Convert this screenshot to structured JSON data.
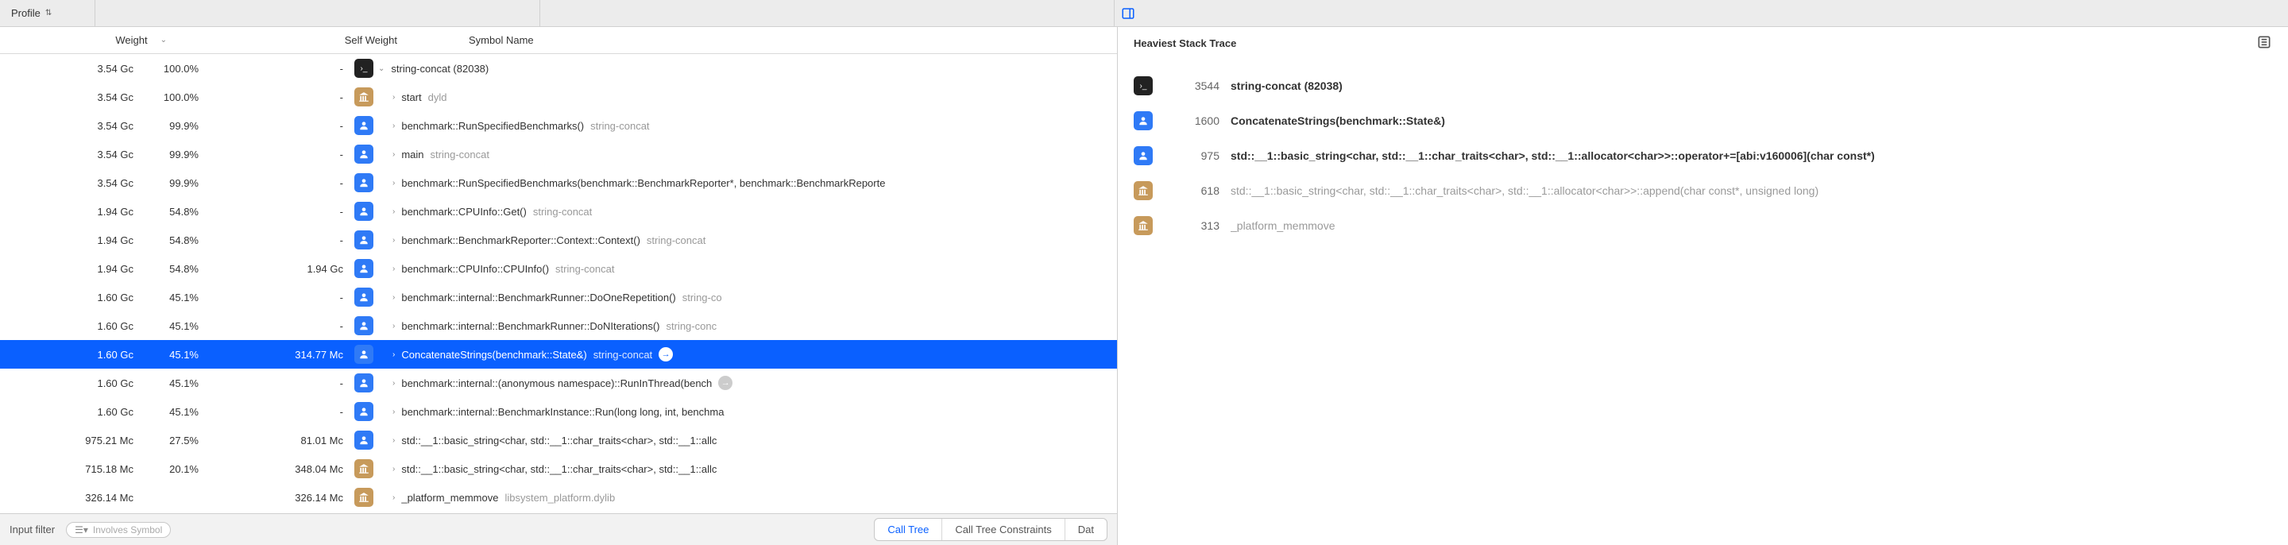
{
  "topbar": {
    "profile_label": "Profile"
  },
  "columns": {
    "weight": "Weight",
    "self": "Self Weight",
    "symbol": "Symbol Name"
  },
  "rows": [
    {
      "weight": "3.54 Gc",
      "pct": "100.0%",
      "self": "-",
      "icon": "term",
      "indent": 0,
      "chev": "down",
      "name": "string-concat (82038)"
    },
    {
      "weight": "3.54 Gc",
      "pct": "100.0%",
      "self": "-",
      "icon": "lib",
      "indent": 1,
      "chev": "right",
      "name": "start",
      "dim": "dyld"
    },
    {
      "weight": "3.54 Gc",
      "pct": "99.9%",
      "self": "-",
      "icon": "user",
      "indent": 1,
      "chev": "right",
      "name": "benchmark::RunSpecifiedBenchmarks()",
      "dim": "string-concat"
    },
    {
      "weight": "3.54 Gc",
      "pct": "99.9%",
      "self": "-",
      "icon": "user",
      "indent": 1,
      "chev": "right",
      "name": "main",
      "dim": "string-concat"
    },
    {
      "weight": "3.54 Gc",
      "pct": "99.9%",
      "self": "-",
      "icon": "user",
      "indent": 1,
      "chev": "right",
      "name": "benchmark::RunSpecifiedBenchmarks(benchmark::BenchmarkReporter*, benchmark::BenchmarkReporte"
    },
    {
      "weight": "1.94 Gc",
      "pct": "54.8%",
      "self": "-",
      "icon": "user",
      "indent": 1,
      "chev": "right",
      "name": "benchmark::CPUInfo::Get()",
      "dim": "string-concat"
    },
    {
      "weight": "1.94 Gc",
      "pct": "54.8%",
      "self": "-",
      "icon": "user",
      "indent": 1,
      "chev": "right",
      "name": "benchmark::BenchmarkReporter::Context::Context()",
      "dim": "string-concat"
    },
    {
      "weight": "1.94 Gc",
      "pct": "54.8%",
      "self": "1.94 Gc",
      "icon": "user",
      "indent": 1,
      "chev": "right",
      "name": "benchmark::CPUInfo::CPUInfo()",
      "dim": "string-concat"
    },
    {
      "weight": "1.60 Gc",
      "pct": "45.1%",
      "self": "-",
      "icon": "user",
      "indent": 1,
      "chev": "right",
      "name": "benchmark::internal::BenchmarkRunner::DoOneRepetition()",
      "dim": "string-co"
    },
    {
      "weight": "1.60 Gc",
      "pct": "45.1%",
      "self": "-",
      "icon": "user",
      "indent": 1,
      "chev": "right",
      "name": "benchmark::internal::BenchmarkRunner::DoNIterations()",
      "dim": "string-conc"
    },
    {
      "weight": "1.60 Gc",
      "pct": "45.1%",
      "self": "314.77 Mc",
      "icon": "user",
      "indent": 1,
      "chev": "right",
      "name": "ConcatenateStrings(benchmark::State&)",
      "dim": "string-concat",
      "selected": true,
      "go": true
    },
    {
      "weight": "1.60 Gc",
      "pct": "45.1%",
      "self": "-",
      "icon": "user",
      "indent": 1,
      "chev": "right",
      "name": "benchmark::internal::(anonymous namespace)::RunInThread(bench",
      "tailcircle": true
    },
    {
      "weight": "1.60 Gc",
      "pct": "45.1%",
      "self": "-",
      "icon": "user",
      "indent": 1,
      "chev": "right",
      "name": "benchmark::internal::BenchmarkInstance::Run(long long, int, benchma"
    },
    {
      "weight": "975.21 Mc",
      "pct": "27.5%",
      "self": "81.01 Mc",
      "icon": "user",
      "indent": 1,
      "chev": "right",
      "name": "std::__1::basic_string<char, std::__1::char_traits<char>, std::__1::allc"
    },
    {
      "weight": "715.18 Mc",
      "pct": "20.1%",
      "self": "348.04 Mc",
      "icon": "lib",
      "indent": 1,
      "chev": "right",
      "name": "std::__1::basic_string<char, std::__1::char_traits<char>, std::__1::allc"
    },
    {
      "weight": "326.14 Mc",
      "pct": "",
      "self": "326.14 Mc",
      "icon": "lib",
      "indent": 1,
      "chev": "right",
      "name": "_platform_memmove",
      "dim": "libsystem_platform.dylib"
    }
  ],
  "bottom": {
    "input_label": "Input filter",
    "involves_placeholder": "Involves Symbol",
    "buttons": [
      "Call Tree",
      "Call Tree Constraints",
      "Dat"
    ],
    "active_index": 0
  },
  "right": {
    "title": "Heaviest Stack Trace",
    "stack": [
      {
        "icon": "term",
        "count": "3544",
        "name": "string-concat (82038)",
        "bold": true
      },
      {
        "icon": "user",
        "count": "1600",
        "name": "ConcatenateStrings(benchmark::State&)",
        "bold": true
      },
      {
        "icon": "user",
        "count": "975",
        "name": "std::__1::basic_string<char, std::__1::char_traits<char>, std::__1::allocator<char>>::operator+=[abi:v160006](char const*)",
        "bold": true
      },
      {
        "icon": "lib",
        "count": "618",
        "name": "std::__1::basic_string<char, std::__1::char_traits<char>, std::__1::allocator<char>>::append(char const*, unsigned long)",
        "dim": true
      },
      {
        "icon": "lib",
        "count": "313",
        "name": "_platform_memmove",
        "dim": true
      }
    ]
  }
}
